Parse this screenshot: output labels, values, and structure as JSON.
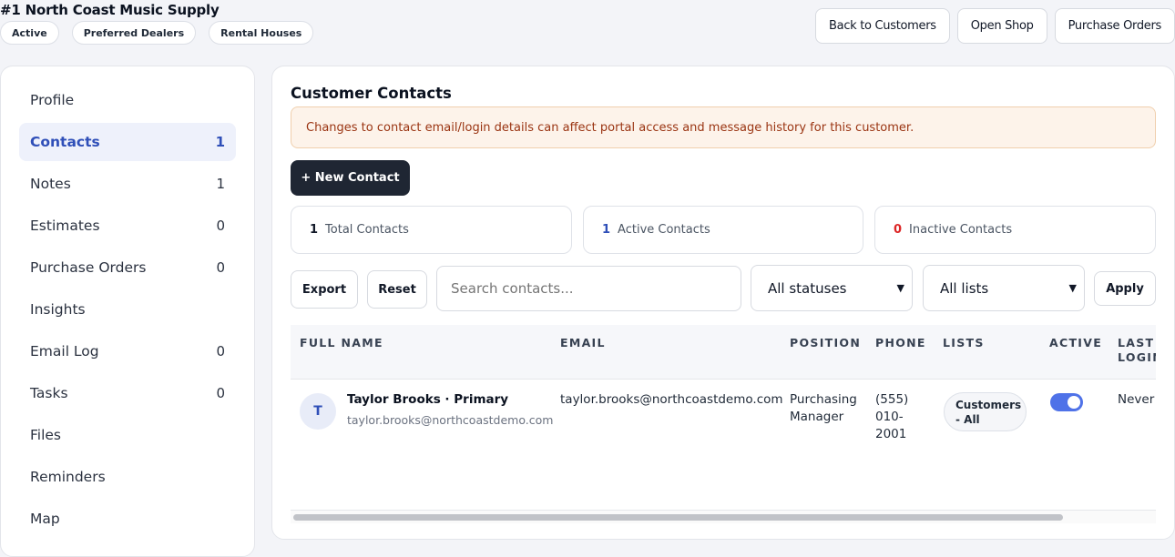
{
  "header": {
    "title": "#1 North Coast Music Supply",
    "tags": [
      "Active",
      "Preferred Dealers",
      "Rental Houses"
    ],
    "actions": [
      "Back to Customers",
      "Open Shop",
      "Purchase Orders"
    ]
  },
  "sidebar": {
    "items": [
      {
        "label": "Profile",
        "count": ""
      },
      {
        "label": "Contacts",
        "count": "1"
      },
      {
        "label": "Notes",
        "count": "1"
      },
      {
        "label": "Estimates",
        "count": "0"
      },
      {
        "label": "Purchase Orders",
        "count": "0"
      },
      {
        "label": "Insights",
        "count": ""
      },
      {
        "label": "Email Log",
        "count": "0"
      },
      {
        "label": "Tasks",
        "count": "0"
      },
      {
        "label": "Files",
        "count": ""
      },
      {
        "label": "Reminders",
        "count": ""
      },
      {
        "label": "Map",
        "count": ""
      }
    ]
  },
  "main": {
    "title": "Customer Contacts",
    "warning": "Changes to contact email/login details can affect portal access and message history for this customer.",
    "new_contact": "+ New Contact",
    "stats": [
      {
        "num": "1",
        "label": "Total Contacts",
        "color": "#111827"
      },
      {
        "num": "1",
        "label": "Active Contacts",
        "color": "#2f4fb8"
      },
      {
        "num": "0",
        "label": "Inactive Contacts",
        "color": "#dc2626"
      }
    ],
    "filters": {
      "export": "Export",
      "reset": "Reset",
      "search_placeholder": "Search contacts...",
      "status_selected": "All statuses",
      "list_selected": "All lists",
      "apply": "Apply"
    },
    "table": {
      "headers": [
        "FULL NAME",
        "EMAIL",
        "POSITION",
        "PHONE",
        "LISTS",
        "ACTIVE",
        "LAST LOGIN"
      ],
      "rows": [
        {
          "initial": "T",
          "name": "Taylor Brooks · Primary",
          "sub_email": "taylor.brooks@northcoastdemo.com",
          "email": "taylor.brooks@northcoastdemo.com",
          "position": "Purchasing Manager",
          "phone": "(555) 010-2001",
          "list": "Customers - All",
          "active": true,
          "last_login": "Never"
        }
      ]
    }
  },
  "colors": {
    "accent": "#2f4fb8",
    "toggle_on": "#4f72e8",
    "warning_bg": "#fdf3ea",
    "warning_text": "#9a3412",
    "dark_button": "#1f2633"
  }
}
